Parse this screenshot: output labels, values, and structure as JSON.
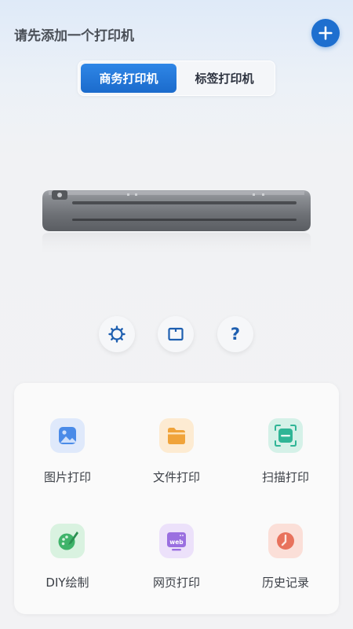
{
  "header": {
    "title": "请先添加一个打印机"
  },
  "segment": {
    "tabs": [
      {
        "label": "商务打印机",
        "active": true
      },
      {
        "label": "标签打印机",
        "active": false
      }
    ]
  },
  "controls": [
    {
      "icon": "settings-gear-icon"
    },
    {
      "icon": "paper-size-icon"
    },
    {
      "icon": "help-question-icon",
      "label": "?"
    }
  ],
  "features": [
    {
      "label": "图片打印",
      "icon": "image-print-icon",
      "color": "#4a8be8"
    },
    {
      "label": "文件打印",
      "icon": "folder-print-icon",
      "color": "#f0a33a"
    },
    {
      "label": "扫描打印",
      "icon": "scan-print-icon",
      "color": "#2fb596"
    },
    {
      "label": "DIY绘制",
      "icon": "diy-draw-icon",
      "color": "#3fb36a"
    },
    {
      "label": "网页打印",
      "icon": "web-print-icon",
      "color": "#9a6fe0"
    },
    {
      "label": "历史记录",
      "icon": "history-clock-icon",
      "color": "#e8725c"
    }
  ],
  "colors": {
    "accent": "#1e6fcf",
    "background": "#f2f2f4"
  }
}
